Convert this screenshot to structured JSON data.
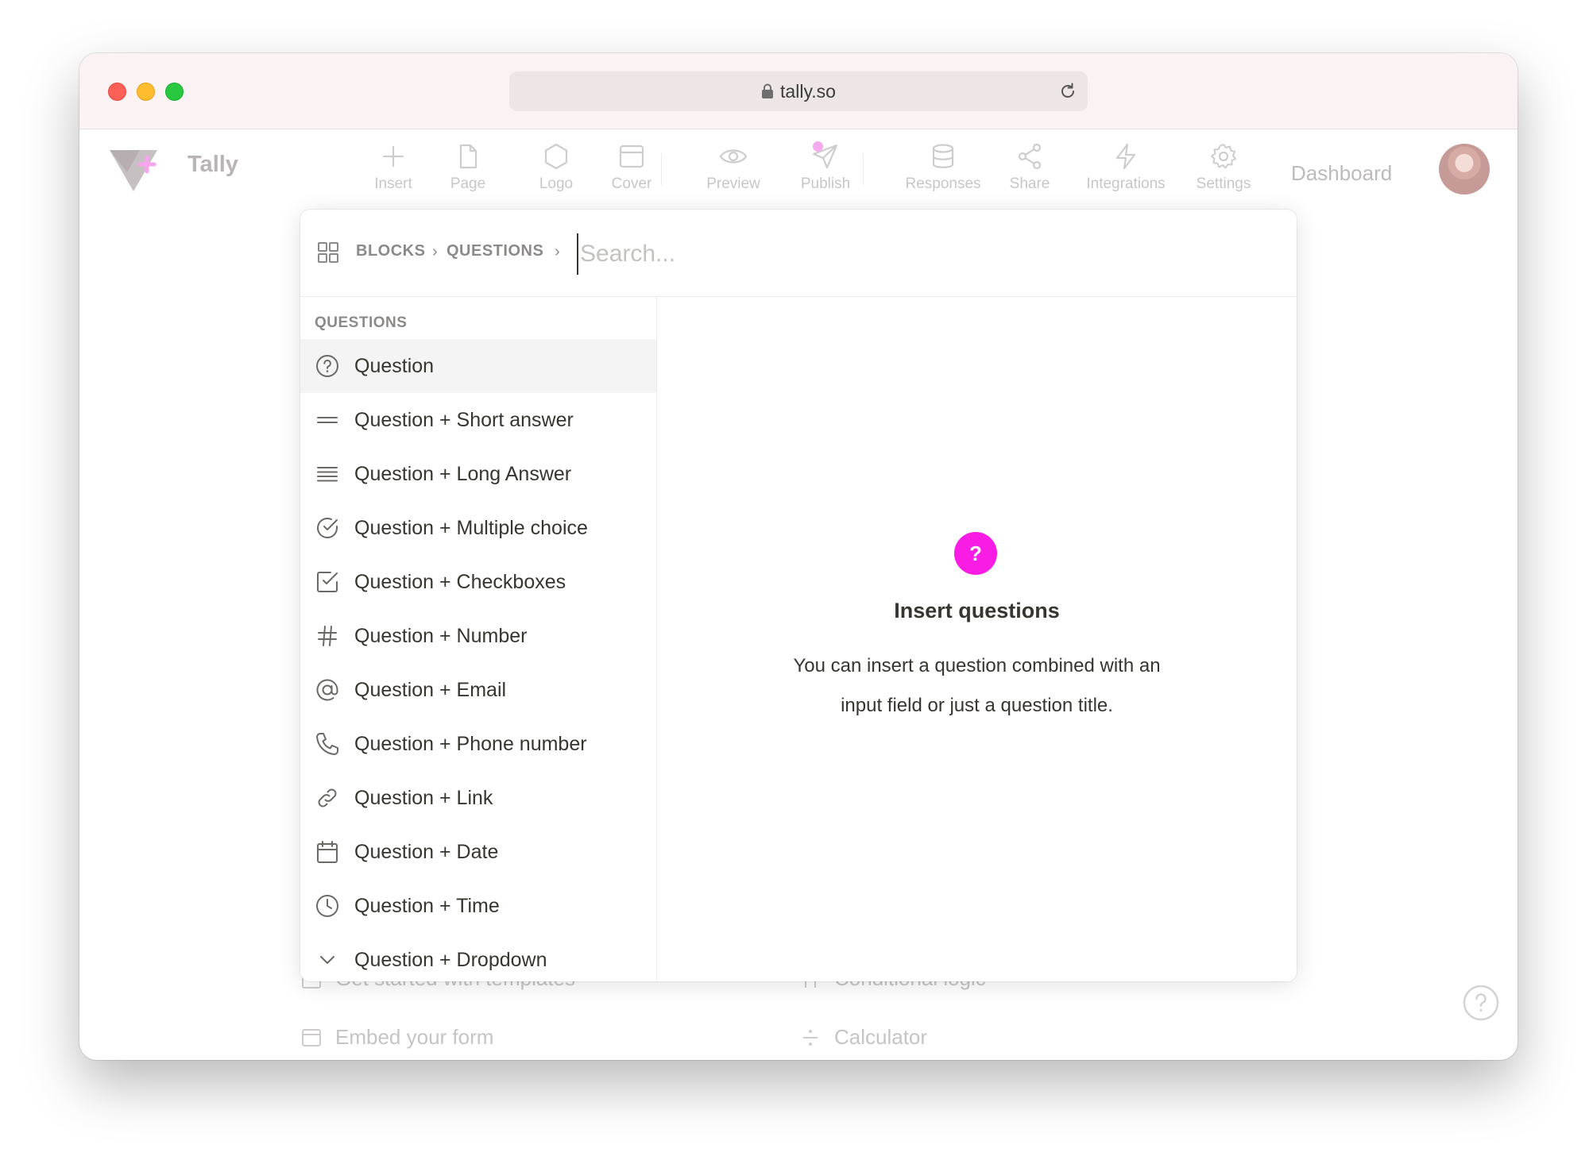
{
  "browser": {
    "url": "tally.so"
  },
  "app": {
    "brand_name": "Tally",
    "toolbar": [
      {
        "id": "insert",
        "label": "Insert",
        "icon": "plus-icon"
      },
      {
        "id": "page",
        "label": "Page",
        "icon": "page-icon"
      },
      {
        "id": "logo",
        "label": "Logo",
        "icon": "hexagon-icon"
      },
      {
        "id": "cover",
        "label": "Cover",
        "icon": "cover-icon"
      },
      {
        "id": "preview",
        "label": "Preview",
        "icon": "eye-icon"
      },
      {
        "id": "publish",
        "label": "Publish",
        "icon": "send-icon"
      },
      {
        "id": "responses",
        "label": "Responses",
        "icon": "database-icon"
      },
      {
        "id": "share",
        "label": "Share",
        "icon": "share-icon"
      },
      {
        "id": "integrations",
        "label": "Integrations",
        "icon": "lightning-icon"
      },
      {
        "id": "settings",
        "label": "Settings",
        "icon": "gear-icon"
      }
    ],
    "dashboard_label": "Dashboard",
    "accent_color": "#f81ce5"
  },
  "background_items": {
    "templates": "Get started with templates",
    "conditional": "Conditional logic",
    "embed": "Embed your form",
    "calculator": "Calculator"
  },
  "modal": {
    "breadcrumb": {
      "blocks": "BLOCKS",
      "questions": "QUESTIONS"
    },
    "search_placeholder": "Search...",
    "section_title": "QUESTIONS",
    "items": [
      {
        "label": "Question",
        "icon": "question-circle-icon",
        "active": true
      },
      {
        "label": "Question + Short answer",
        "icon": "short-answer-icon"
      },
      {
        "label": "Question + Long Answer",
        "icon": "long-answer-icon"
      },
      {
        "label": "Question + Multiple choice",
        "icon": "check-circle-icon"
      },
      {
        "label": "Question + Checkboxes",
        "icon": "checkbox-icon"
      },
      {
        "label": "Question + Number",
        "icon": "hash-icon"
      },
      {
        "label": "Question + Email",
        "icon": "at-icon"
      },
      {
        "label": "Question + Phone number",
        "icon": "phone-icon"
      },
      {
        "label": "Question + Link",
        "icon": "link-icon"
      },
      {
        "label": "Question + Date",
        "icon": "calendar-icon"
      },
      {
        "label": "Question + Time",
        "icon": "clock-icon"
      },
      {
        "label": "Question + Dropdown",
        "icon": "chevron-down-icon"
      }
    ],
    "preview": {
      "badge": "?",
      "title": "Insert questions",
      "description": "You can insert a question combined with an input field or just a question title."
    }
  }
}
